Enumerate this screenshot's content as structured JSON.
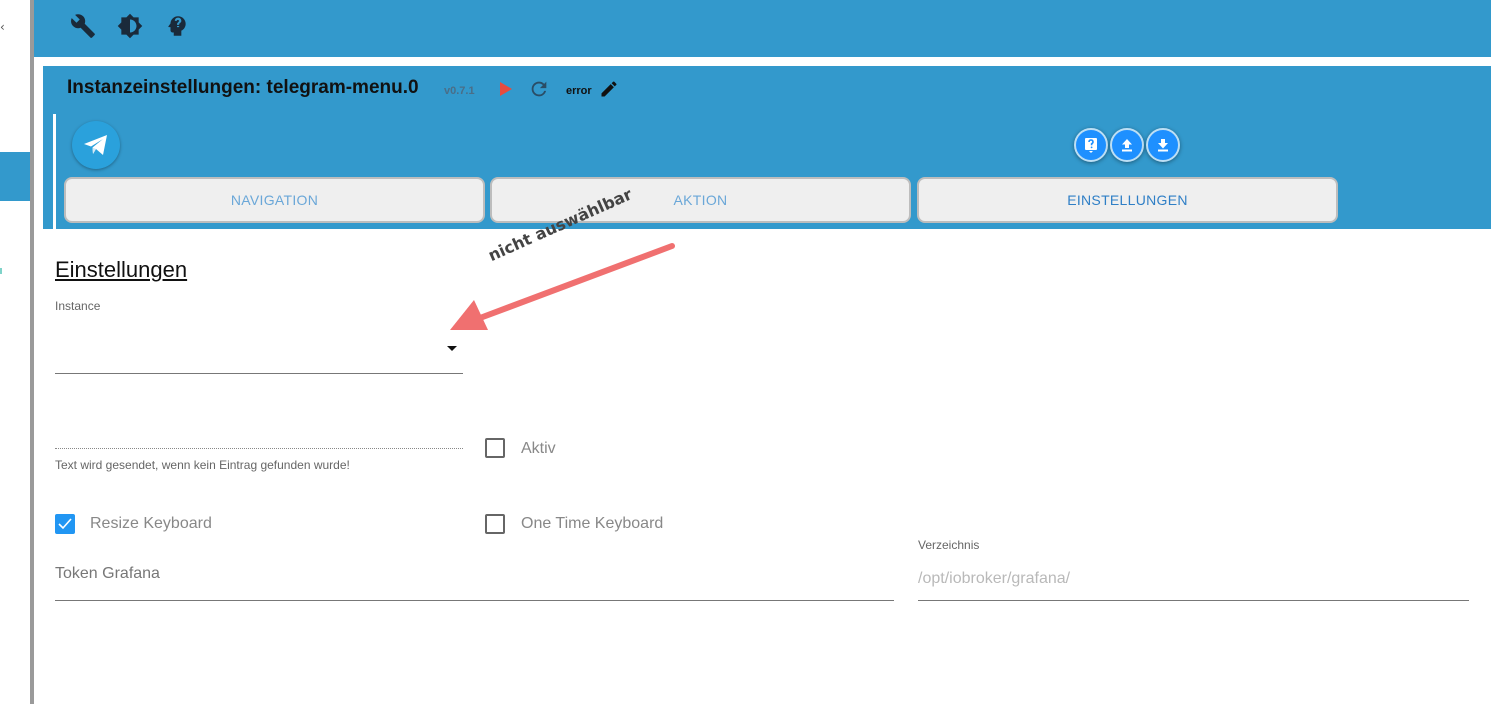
{
  "header": {
    "title": "Instanzeinstellungen: telegram-menu.0",
    "version": "v0.7.1",
    "status": "error"
  },
  "toolbar": {
    "icons": [
      "wrench-icon",
      "brightness-icon",
      "expert-mode-icon"
    ]
  },
  "tabs": [
    {
      "label": "NAVIGATION",
      "selected": false
    },
    {
      "label": "AKTION",
      "selected": false
    },
    {
      "label": "EINSTELLUNGEN",
      "selected": true
    }
  ],
  "settings": {
    "heading": "Einstellungen",
    "instance_label": "Instance",
    "instance_value": "",
    "fallback_text_value": "",
    "fallback_helper": "Text wird gesendet, wenn kein Eintrag gefunden wurde!",
    "aktiv_label": "Aktiv",
    "aktiv_checked": false,
    "resize_keyboard_label": "Resize Keyboard",
    "resize_keyboard_checked": true,
    "one_time_keyboard_label": "One Time Keyboard",
    "one_time_keyboard_checked": false,
    "token_grafana_placeholder": "Token Grafana",
    "directory_label": "Verzeichnis",
    "directory_placeholder": "/opt/iobroker/grafana/"
  },
  "annotation": {
    "text": "nicht auswählbar",
    "arrow_color": "#f07070"
  },
  "colors": {
    "header_blue": "#3399cc",
    "accent_blue": "#2196f3",
    "play_red": "#e84c3d"
  }
}
